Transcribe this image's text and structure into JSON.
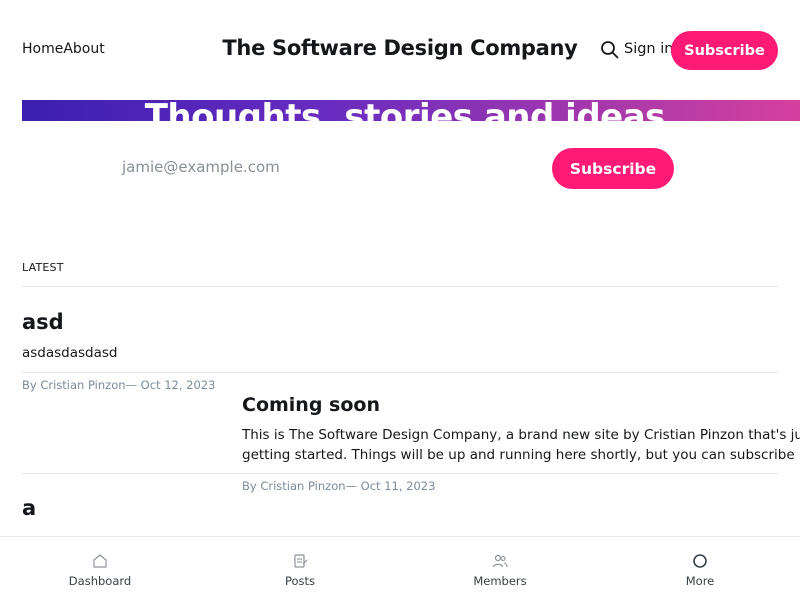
{
  "header": {
    "nav": [
      "Home",
      "About"
    ],
    "site_title": "The Software Design Company",
    "sign_in": "Sign in",
    "subscribe": "Subscribe",
    "search_icon": "search-icon"
  },
  "hero": {
    "title": "Thoughts, stories and ideas."
  },
  "subscribe_form": {
    "email_placeholder": "jamie@example.com",
    "button": "Subscribe"
  },
  "latest": {
    "label": "LATEST",
    "posts": [
      {
        "title": "asd",
        "excerpt": "asdasdasdasd",
        "meta": "By Cristian Pinzon— Oct 12, 2023"
      },
      {
        "title": "Coming soon",
        "excerpt_line1": "This is The Software Design Company, a brand new site by Cristian Pinzon that's just",
        "excerpt_line2": "getting started. Things will be up and running here shortly, but you can subscribe …",
        "meta": "By Cristian Pinzon— Oct 11, 2023"
      },
      {
        "title": "a"
      }
    ]
  },
  "bottom_nav": [
    {
      "label": "Dashboard",
      "icon": "home-icon"
    },
    {
      "label": "Posts",
      "icon": "posts-icon"
    },
    {
      "label": "Members",
      "icon": "members-icon"
    },
    {
      "label": "More",
      "icon": "circle-icon"
    }
  ],
  "colors": {
    "accent": "#ff1a75",
    "hero_gradient_start": "#3a1fb0",
    "hero_gradient_end": "#d6409f"
  }
}
